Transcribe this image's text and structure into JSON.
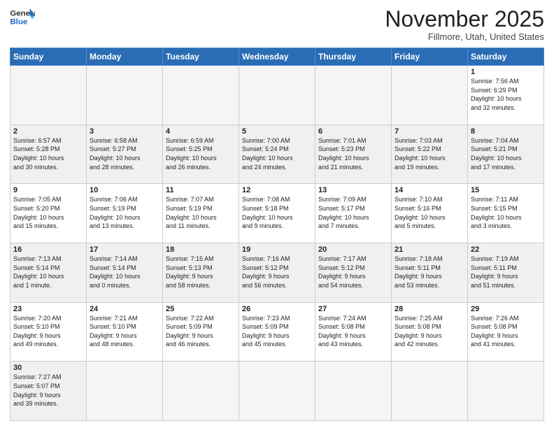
{
  "header": {
    "logo_general": "General",
    "logo_blue": "Blue",
    "month_title": "November 2025",
    "location": "Fillmore, Utah, United States"
  },
  "days_of_week": [
    "Sunday",
    "Monday",
    "Tuesday",
    "Wednesday",
    "Thursday",
    "Friday",
    "Saturday"
  ],
  "weeks": [
    [
      {
        "day": "",
        "info": ""
      },
      {
        "day": "",
        "info": ""
      },
      {
        "day": "",
        "info": ""
      },
      {
        "day": "",
        "info": ""
      },
      {
        "day": "",
        "info": ""
      },
      {
        "day": "",
        "info": ""
      },
      {
        "day": "1",
        "info": "Sunrise: 7:56 AM\nSunset: 6:29 PM\nDaylight: 10 hours\nand 32 minutes."
      }
    ],
    [
      {
        "day": "2",
        "info": "Sunrise: 6:57 AM\nSunset: 5:28 PM\nDaylight: 10 hours\nand 30 minutes."
      },
      {
        "day": "3",
        "info": "Sunrise: 6:58 AM\nSunset: 5:27 PM\nDaylight: 10 hours\nand 28 minutes."
      },
      {
        "day": "4",
        "info": "Sunrise: 6:59 AM\nSunset: 5:25 PM\nDaylight: 10 hours\nand 26 minutes."
      },
      {
        "day": "5",
        "info": "Sunrise: 7:00 AM\nSunset: 5:24 PM\nDaylight: 10 hours\nand 24 minutes."
      },
      {
        "day": "6",
        "info": "Sunrise: 7:01 AM\nSunset: 5:23 PM\nDaylight: 10 hours\nand 21 minutes."
      },
      {
        "day": "7",
        "info": "Sunrise: 7:03 AM\nSunset: 5:22 PM\nDaylight: 10 hours\nand 19 minutes."
      },
      {
        "day": "8",
        "info": "Sunrise: 7:04 AM\nSunset: 5:21 PM\nDaylight: 10 hours\nand 17 minutes."
      }
    ],
    [
      {
        "day": "9",
        "info": "Sunrise: 7:05 AM\nSunset: 5:20 PM\nDaylight: 10 hours\nand 15 minutes."
      },
      {
        "day": "10",
        "info": "Sunrise: 7:06 AM\nSunset: 5:19 PM\nDaylight: 10 hours\nand 13 minutes."
      },
      {
        "day": "11",
        "info": "Sunrise: 7:07 AM\nSunset: 5:19 PM\nDaylight: 10 hours\nand 11 minutes."
      },
      {
        "day": "12",
        "info": "Sunrise: 7:08 AM\nSunset: 5:18 PM\nDaylight: 10 hours\nand 9 minutes."
      },
      {
        "day": "13",
        "info": "Sunrise: 7:09 AM\nSunset: 5:17 PM\nDaylight: 10 hours\nand 7 minutes."
      },
      {
        "day": "14",
        "info": "Sunrise: 7:10 AM\nSunset: 5:16 PM\nDaylight: 10 hours\nand 5 minutes."
      },
      {
        "day": "15",
        "info": "Sunrise: 7:11 AM\nSunset: 5:15 PM\nDaylight: 10 hours\nand 3 minutes."
      }
    ],
    [
      {
        "day": "16",
        "info": "Sunrise: 7:13 AM\nSunset: 5:14 PM\nDaylight: 10 hours\nand 1 minute."
      },
      {
        "day": "17",
        "info": "Sunrise: 7:14 AM\nSunset: 5:14 PM\nDaylight: 10 hours\nand 0 minutes."
      },
      {
        "day": "18",
        "info": "Sunrise: 7:15 AM\nSunset: 5:13 PM\nDaylight: 9 hours\nand 58 minutes."
      },
      {
        "day": "19",
        "info": "Sunrise: 7:16 AM\nSunset: 5:12 PM\nDaylight: 9 hours\nand 56 minutes."
      },
      {
        "day": "20",
        "info": "Sunrise: 7:17 AM\nSunset: 5:12 PM\nDaylight: 9 hours\nand 54 minutes."
      },
      {
        "day": "21",
        "info": "Sunrise: 7:18 AM\nSunset: 5:11 PM\nDaylight: 9 hours\nand 53 minutes."
      },
      {
        "day": "22",
        "info": "Sunrise: 7:19 AM\nSunset: 5:11 PM\nDaylight: 9 hours\nand 51 minutes."
      }
    ],
    [
      {
        "day": "23",
        "info": "Sunrise: 7:20 AM\nSunset: 5:10 PM\nDaylight: 9 hours\nand 49 minutes."
      },
      {
        "day": "24",
        "info": "Sunrise: 7:21 AM\nSunset: 5:10 PM\nDaylight: 9 hours\nand 48 minutes."
      },
      {
        "day": "25",
        "info": "Sunrise: 7:22 AM\nSunset: 5:09 PM\nDaylight: 9 hours\nand 46 minutes."
      },
      {
        "day": "26",
        "info": "Sunrise: 7:23 AM\nSunset: 5:09 PM\nDaylight: 9 hours\nand 45 minutes."
      },
      {
        "day": "27",
        "info": "Sunrise: 7:24 AM\nSunset: 5:08 PM\nDaylight: 9 hours\nand 43 minutes."
      },
      {
        "day": "28",
        "info": "Sunrise: 7:25 AM\nSunset: 5:08 PM\nDaylight: 9 hours\nand 42 minutes."
      },
      {
        "day": "29",
        "info": "Sunrise: 7:26 AM\nSunset: 5:08 PM\nDaylight: 9 hours\nand 41 minutes."
      }
    ],
    [
      {
        "day": "30",
        "info": "Sunrise: 7:27 AM\nSunset: 5:07 PM\nDaylight: 9 hours\nand 39 minutes."
      },
      {
        "day": "",
        "info": ""
      },
      {
        "day": "",
        "info": ""
      },
      {
        "day": "",
        "info": ""
      },
      {
        "day": "",
        "info": ""
      },
      {
        "day": "",
        "info": ""
      },
      {
        "day": "",
        "info": ""
      }
    ]
  ]
}
